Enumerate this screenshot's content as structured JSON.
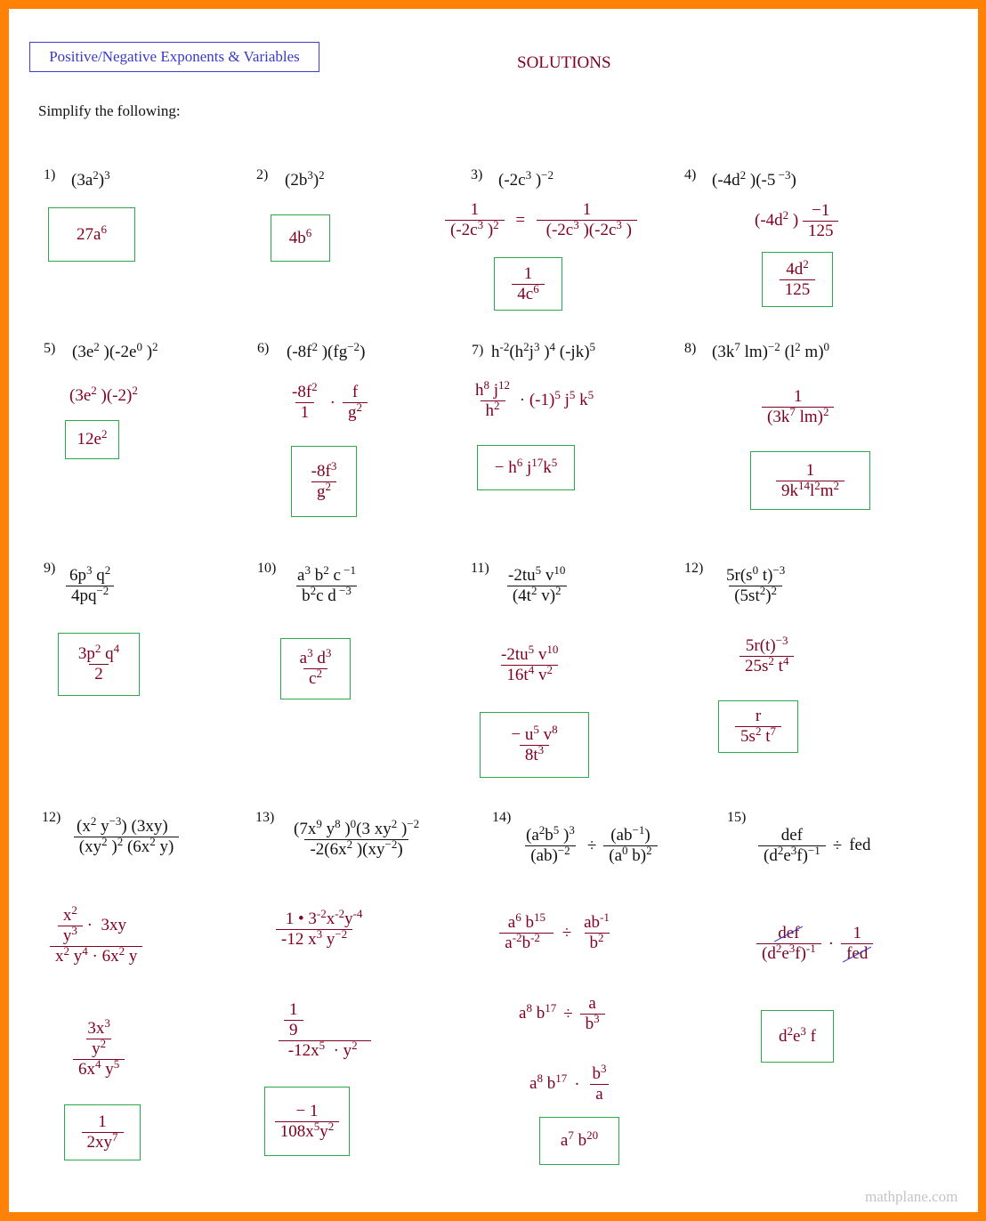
{
  "header": {
    "title": "Positive/Negative Exponents & Variables",
    "heading": "SOLUTIONS",
    "instruction": "Simplify the following:"
  },
  "colors": {
    "border": "#ff8207",
    "work": "#800020",
    "answer_box": "#2aa84a",
    "title": "#3a3ac8"
  },
  "problems": [
    {
      "label": "1)",
      "problem": "(3a^2)^3",
      "steps": [],
      "answer": "27a^6"
    },
    {
      "label": "2)",
      "problem": "(2b^3)^2",
      "steps": [],
      "answer": "4b^6"
    },
    {
      "label": "3)",
      "problem": "(-2c^3)^-2",
      "steps": [
        "1/(-2c^3)^2 = 1/((-2c^3)(-2c^3))"
      ],
      "answer": "1/(4c^6)"
    },
    {
      "label": "4)",
      "problem": "(-4d^2)(-5^-3)",
      "steps": [
        "(-4d^2) (-1/125)"
      ],
      "answer": "4d^2/125"
    },
    {
      "label": "5)",
      "problem": "(3e^2)(-2e^0)^2",
      "steps": [
        "(3e^2)(-2)^2"
      ],
      "answer": "12e^2"
    },
    {
      "label": "6)",
      "problem": "(-8f^2)(fg^-2)",
      "steps": [
        "-8f^2/1 · f/g^2"
      ],
      "answer": "-8f^3/g^2"
    },
    {
      "label": "7)",
      "problem": "h^-2(h^2 j^3)^4 (-jk)^5",
      "steps": [
        "h^8 j^12/h^2 · (-1)^5 j^5 k^5"
      ],
      "answer": "−h^6 j^17 k^5"
    },
    {
      "label": "8)",
      "problem": "(3k^7 lm)^-2 (l^2 m)^0",
      "steps": [
        "1/(3k^7 lm)^2"
      ],
      "answer": "1/(9k^14 l^2 m^2)"
    },
    {
      "label": "9)",
      "problem": "6p^3 q^2 / 4pq^-2",
      "steps": [],
      "answer": "3p^2 q^4/2"
    },
    {
      "label": "10)",
      "problem": "a^3 b^2 c^-1 / b^2 c d^-3",
      "steps": [],
      "answer": "a^3 d^3/c^2"
    },
    {
      "label": "11)",
      "problem": "-2tu^5 v^10 / (4t^2 v)^2",
      "steps": [
        "-2tu^5 v^10 / 16t^4 v^2"
      ],
      "answer": "−u^5 v^8/8t^3"
    },
    {
      "label": "12)",
      "problem": "5r(s^0 t)^-3 / (5st^2)^2",
      "steps": [
        "5r(t)^-3 / 25s^2 t^4"
      ],
      "answer": "r/5s^2 t^7"
    },
    {
      "label": "12)",
      "problem": "(x^2 y^-3)(3xy) / (xy^2)^2 (6x^2 y)",
      "steps": [
        "(x^2/y^3 · 3xy) / (x^2 y^4 · 6x^2 y)",
        "(3x^3/y^2) / 6x^4 y^5"
      ],
      "answer": "1/2xy^7"
    },
    {
      "label": "13)",
      "problem": "(7x^9 y^8)^0 (3xy^2)^-2 / -2(6x^2)(xy^-2)",
      "steps": [
        "1 • 3^-2 x^-2 y^-4 / -12x^3 y^-2",
        "(1/9) / -12x^5 · y^2"
      ],
      "answer": "−1/108x^5 y^2"
    },
    {
      "label": "14)",
      "problem": "(a^2 b^5)^3/(ab)^-2 ÷ (ab^-1)/(a^0 b)^2",
      "steps": [
        "a^6 b^15/a^-2 b^-2 ÷ ab^-1/b^2",
        "a^8 b^17 ÷ a/b^3",
        "a^8 b^17 · b^3/a"
      ],
      "answer": "a^7 b^20"
    },
    {
      "label": "15)",
      "problem": "def/(d^2 e^3 f)^-1 ÷ fed",
      "steps": [
        "def/(d^2 e^3 f)^-1 · 1/fed"
      ],
      "answer": "d^2 e^3 f"
    }
  ],
  "footer": {
    "watermark": "mathplane.com"
  }
}
